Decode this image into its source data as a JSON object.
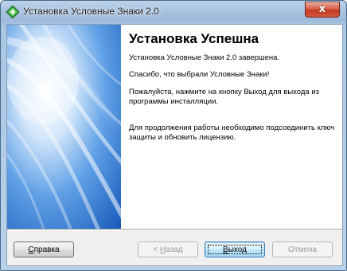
{
  "window": {
    "title": "Установка Условные Знаки 2.0",
    "close_label": "x",
    "icon": "green-diamond-installer-icon"
  },
  "content": {
    "heading": "Установка Успешна",
    "paragraphs": [
      "Установка Условные Знаки 2.0 завершена.",
      "Спасибо, что выбрали Условные Знаки!",
      "Пожалуйста, нажмите на кнопку Выход для выхода из программы инсталляции.",
      "Для продолжения работы необходимо подсоединить ключ защиты и обновить лицензию."
    ]
  },
  "buttons": {
    "help": {
      "mnemonic": "С",
      "rest": "правка"
    },
    "back": {
      "prefix": "< ",
      "mnemonic": "Н",
      "rest": "азад",
      "disabled": true
    },
    "exit": {
      "mnemonic": "В",
      "rest": "ыход",
      "default": true
    },
    "cancel": {
      "label": "Отмена",
      "disabled": true
    }
  },
  "colors": {
    "side_panel_base": "#1f6fd0",
    "side_panel_light": "#e8f2fc",
    "default_button_border": "#3c7fb1",
    "close_button": "#c23a22"
  }
}
